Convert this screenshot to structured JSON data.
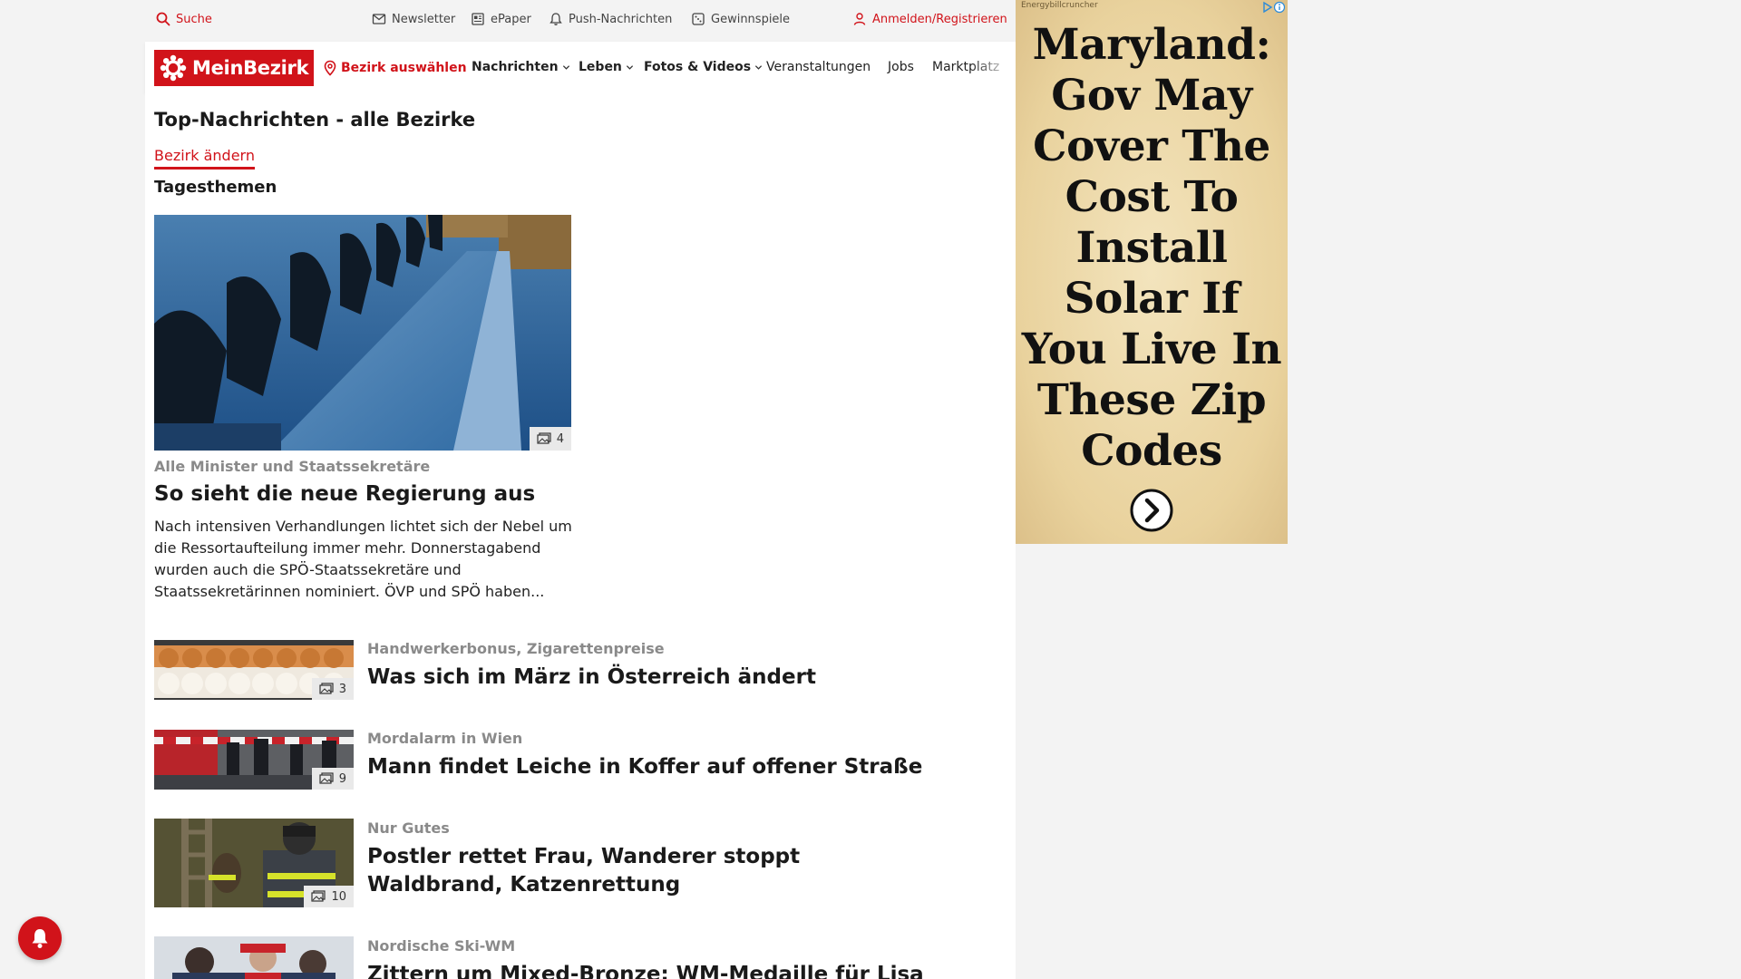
{
  "colors": {
    "brand_red": "#d1131a",
    "kicker_gray": "#8a8a8a",
    "ad_bg": "#e9d29d"
  },
  "utility_bar": {
    "search_label": "Suche",
    "newsletter_label": "Newsletter",
    "epaper_label": "ePaper",
    "push_label": "Push-Nachrichten",
    "gewinnspiele_label": "Gewinnspiele",
    "login_label": "Anmelden/Registrieren"
  },
  "nav": {
    "logo_text": "MeinBezirk",
    "district_label": "Bezirk auswählen",
    "items": [
      {
        "label": "Nachrichten",
        "has_dropdown": true
      },
      {
        "label": "Leben",
        "has_dropdown": true
      },
      {
        "label": "Fotos & Videos",
        "has_dropdown": true
      },
      {
        "label": "Veranstaltungen",
        "has_dropdown": false
      },
      {
        "label": "Jobs",
        "has_dropdown": false
      },
      {
        "label": "Marktplatz",
        "has_dropdown": false
      }
    ]
  },
  "page": {
    "title": "Top-Nachrichten - alle Bezirke",
    "change_district": "Bezirk ändern",
    "section": "Tagesthemen"
  },
  "hero": {
    "image_count": "4",
    "kicker": "Alle Minister und Staatssekretäre",
    "headline": "So sieht die neue Regierung aus",
    "teaser": "Nach intensiven Verhandlungen lichtet sich der Nebel um die Ressortaufteilung immer mehr. Donnerstagabend wurden auch die SPÖ-Staatssekretäre und Staatssekretärinnen nominiert. ÖVP und SPÖ haben..."
  },
  "articles": [
    {
      "image_count": "3",
      "kicker": "Handwerkerbonus, Zigarettenpreise",
      "headline": "Was sich im März in Österreich ändert"
    },
    {
      "image_count": "9",
      "kicker": "Mordalarm in Wien",
      "headline": "Mann findet Leiche in Koffer auf offener Straße"
    },
    {
      "image_count": "10",
      "kicker": "Nur Gutes",
      "headline": "Postler rettet Frau, Wanderer stoppt Waldbrand, Katzenrettung"
    },
    {
      "image_count": "",
      "kicker": "Nordische Ski-WM",
      "headline": "Zittern um Mixed-Bronze: WM-Medaille für Lisa Hirner"
    }
  ],
  "ad": {
    "source": "Energybillcruncher",
    "headline": "Maryland: Gov May Cover The Cost To Install Solar If You Live In These Zip Codes"
  }
}
